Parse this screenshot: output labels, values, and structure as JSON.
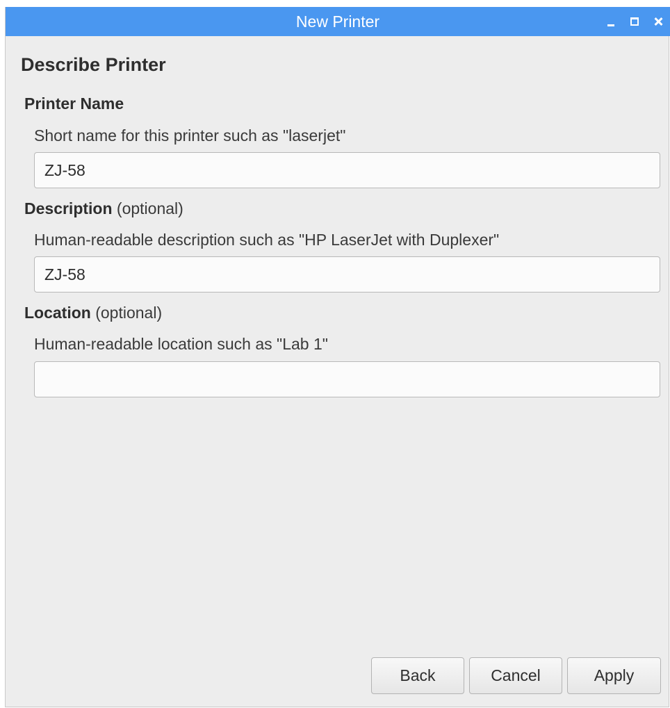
{
  "window": {
    "title": "New Printer",
    "controls": {
      "minimize": "minimize-icon",
      "maximize": "maximize-icon",
      "close": "close-icon"
    }
  },
  "page": {
    "heading": "Describe Printer"
  },
  "printer_name": {
    "label": "Printer Name",
    "hint": "Short name for this printer such as \"laserjet\"",
    "value": "ZJ-58"
  },
  "description": {
    "label": "Description",
    "optional": "(optional)",
    "hint": "Human-readable description such as \"HP LaserJet with Duplexer\"",
    "value": "ZJ-58"
  },
  "location": {
    "label": "Location",
    "optional": "(optional)",
    "hint": "Human-readable location such as \"Lab 1\"",
    "value": ""
  },
  "buttons": {
    "back": "Back",
    "cancel": "Cancel",
    "apply": "Apply"
  },
  "colors": {
    "titlebar": "#4a97f0",
    "background": "#ededed"
  }
}
